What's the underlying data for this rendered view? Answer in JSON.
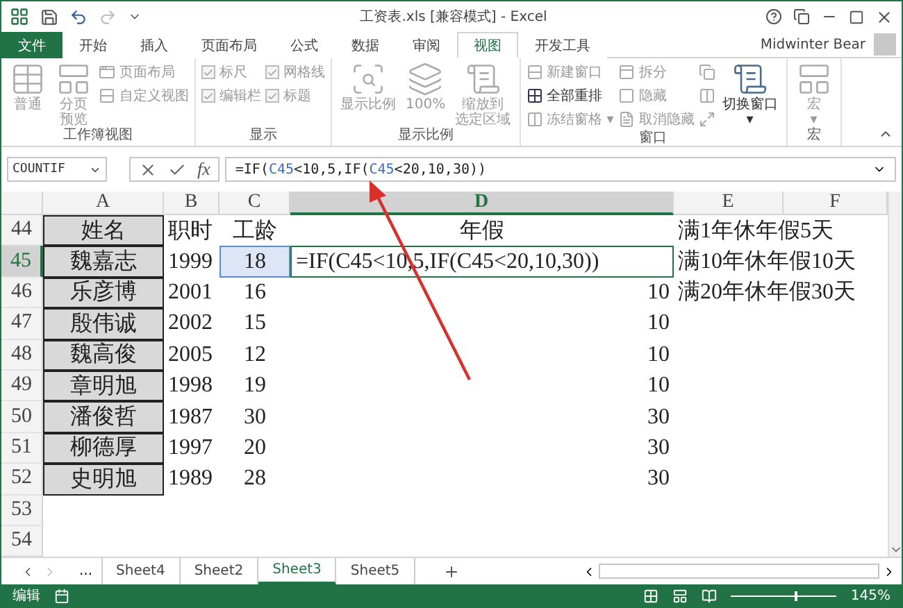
{
  "window": {
    "title": "工资表.xls  [兼容模式] - Excel"
  },
  "ribbon_tabs": [
    {
      "label": "文件",
      "kind": "file",
      "selected": false
    },
    {
      "label": "开始",
      "kind": "tab",
      "selected": false
    },
    {
      "label": "插入",
      "kind": "tab",
      "selected": false
    },
    {
      "label": "页面布局",
      "kind": "tab",
      "selected": false
    },
    {
      "label": "公式",
      "kind": "tab",
      "selected": false
    },
    {
      "label": "数据",
      "kind": "tab",
      "selected": false
    },
    {
      "label": "审阅",
      "kind": "tab",
      "selected": false
    },
    {
      "label": "视图",
      "kind": "tab",
      "selected": true
    },
    {
      "label": "开发工具",
      "kind": "tab",
      "selected": false
    }
  ],
  "user": {
    "name": "Midwinter Bear"
  },
  "ribbon_groups": [
    {
      "label": "工作簿视图",
      "items": [
        {
          "kind": "large",
          "label": "普通",
          "disabled": true
        },
        {
          "kind": "large",
          "lines": [
            "分页",
            "预览"
          ],
          "disabled": true
        },
        {
          "kind": "small",
          "label": "页面布局",
          "disabled": true
        },
        {
          "kind": "small",
          "label": "自定义视图",
          "disabled": true
        }
      ]
    },
    {
      "label": "显示",
      "items": [
        {
          "kind": "checkbox",
          "label": "标尺",
          "checked": true,
          "disabled": true
        },
        {
          "kind": "checkbox",
          "label": "编辑栏",
          "checked": true,
          "disabled": true
        },
        {
          "kind": "checkbox",
          "label": "网格线",
          "checked": true,
          "disabled": true
        },
        {
          "kind": "checkbox",
          "label": "标题",
          "checked": true,
          "disabled": true
        }
      ]
    },
    {
      "label": "显示比例",
      "items": [
        {
          "kind": "large",
          "label": "显示比例",
          "disabled": true
        },
        {
          "kind": "large",
          "label": "100%",
          "disabled": true
        },
        {
          "kind": "large",
          "lines": [
            "缩放到",
            "选定区域"
          ],
          "disabled": true
        }
      ]
    },
    {
      "label": "窗口",
      "items": [
        {
          "kind": "small",
          "label": "新建窗口",
          "disabled": true
        },
        {
          "kind": "small",
          "label": "全部重排",
          "disabled": false
        },
        {
          "kind": "small",
          "label": "冻结窗格 ▾",
          "disabled": true
        },
        {
          "kind": "small",
          "label": "拆分",
          "disabled": true
        },
        {
          "kind": "small",
          "label": "隐藏",
          "disabled": true
        },
        {
          "kind": "small",
          "label": "取消隐藏",
          "disabled": true
        },
        {
          "kind": "icon",
          "disabled": true
        },
        {
          "kind": "icon",
          "disabled": true
        },
        {
          "kind": "icon",
          "disabled": true
        },
        {
          "kind": "large",
          "lines": [
            "切换窗口",
            "▾"
          ],
          "disabled": false
        }
      ]
    },
    {
      "label": "宏",
      "items": [
        {
          "kind": "large",
          "lines": [
            "宏",
            "▾"
          ],
          "disabled": true
        }
      ]
    }
  ],
  "formula_bar": {
    "name_box": "COUNTIF",
    "fx": "fx",
    "segments": [
      {
        "text": "=IF(",
        "color": "#222222"
      },
      {
        "text": "C45",
        "color": "#3b6fb6"
      },
      {
        "text": "<10,5,IF(",
        "color": "#222222"
      },
      {
        "text": "C45",
        "color": "#3b6fb6"
      },
      {
        "text": "<20,10,30))",
        "color": "#222222"
      }
    ]
  },
  "sheet": {
    "columns": [
      {
        "label": "A",
        "selected": false
      },
      {
        "label": "B",
        "selected": false
      },
      {
        "label": "C",
        "selected": false
      },
      {
        "label": "D",
        "selected": true
      },
      {
        "label": "E",
        "selected": false
      },
      {
        "label": "F",
        "selected": false
      }
    ],
    "rows": [
      {
        "header": "44",
        "selected": false,
        "editing": false,
        "referenced": false,
        "cells": [
          "姓名",
          "职时",
          "工龄",
          "年假",
          "满1年休年假5天"
        ]
      },
      {
        "header": "45",
        "selected": true,
        "editing": true,
        "referenced": true,
        "cells": [
          "魏嘉志",
          "1999",
          "18",
          "=IF(C45<10,5,IF(C45<20,10,30))",
          "满10年休年假10天"
        ]
      },
      {
        "header": "46",
        "selected": false,
        "editing": false,
        "referenced": false,
        "cells": [
          "乐彦博",
          "2001",
          "16",
          "10",
          "满20年休年假30天"
        ]
      },
      {
        "header": "47",
        "selected": false,
        "editing": false,
        "referenced": false,
        "cells": [
          "殷伟诚",
          "2002",
          "15",
          "10"
        ]
      },
      {
        "header": "48",
        "selected": false,
        "editing": false,
        "referenced": false,
        "cells": [
          "魏高俊",
          "2005",
          "12",
          "10"
        ]
      },
      {
        "header": "49",
        "selected": false,
        "editing": false,
        "referenced": false,
        "cells": [
          "章明旭",
          "1998",
          "19",
          "10"
        ]
      },
      {
        "header": "50",
        "selected": false,
        "editing": false,
        "referenced": false,
        "cells": [
          "潘俊哲",
          "1987",
          "30",
          "30"
        ]
      },
      {
        "header": "51",
        "selected": false,
        "editing": false,
        "referenced": false,
        "cells": [
          "柳德厚",
          "1997",
          "20",
          "30"
        ]
      },
      {
        "header": "52",
        "selected": false,
        "editing": false,
        "referenced": false,
        "cells": [
          "史明旭",
          "1989",
          "28",
          "30"
        ]
      },
      {
        "header": "53",
        "selected": false,
        "editing": false,
        "referenced": false,
        "cells": []
      },
      {
        "header": "54",
        "selected": false,
        "editing": false,
        "referenced": false,
        "cells": []
      }
    ]
  },
  "sheet_tabs": {
    "more": "...",
    "tabs": [
      {
        "label": "Sheet4",
        "selected": false
      },
      {
        "label": "Sheet2",
        "selected": false
      },
      {
        "label": "Sheet3",
        "selected": true
      },
      {
        "label": "Sheet5",
        "selected": false
      }
    ]
  },
  "status_bar": {
    "mode": "编辑",
    "zoom": "145%",
    "level": 0.6
  }
}
